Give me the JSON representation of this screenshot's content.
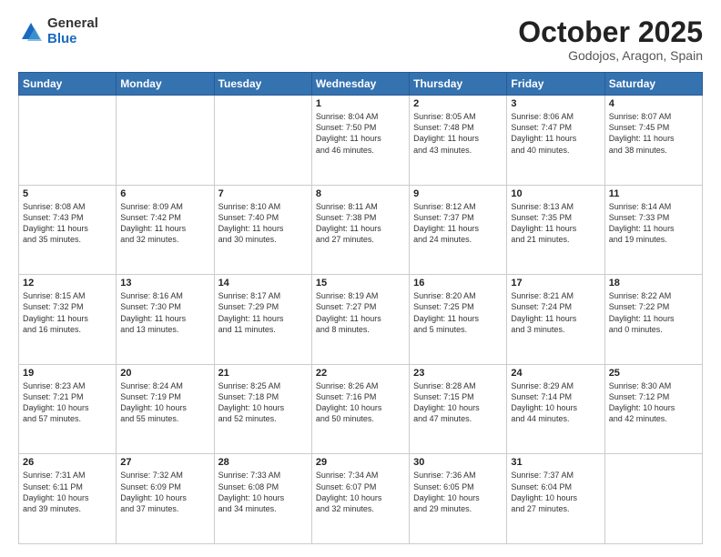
{
  "logo": {
    "general": "General",
    "blue": "Blue"
  },
  "title": "October 2025",
  "location": "Godojos, Aragon, Spain",
  "days_of_week": [
    "Sunday",
    "Monday",
    "Tuesday",
    "Wednesday",
    "Thursday",
    "Friday",
    "Saturday"
  ],
  "weeks": [
    [
      {
        "day": "",
        "info": ""
      },
      {
        "day": "",
        "info": ""
      },
      {
        "day": "",
        "info": ""
      },
      {
        "day": "1",
        "info": "Sunrise: 8:04 AM\nSunset: 7:50 PM\nDaylight: 11 hours\nand 46 minutes."
      },
      {
        "day": "2",
        "info": "Sunrise: 8:05 AM\nSunset: 7:48 PM\nDaylight: 11 hours\nand 43 minutes."
      },
      {
        "day": "3",
        "info": "Sunrise: 8:06 AM\nSunset: 7:47 PM\nDaylight: 11 hours\nand 40 minutes."
      },
      {
        "day": "4",
        "info": "Sunrise: 8:07 AM\nSunset: 7:45 PM\nDaylight: 11 hours\nand 38 minutes."
      }
    ],
    [
      {
        "day": "5",
        "info": "Sunrise: 8:08 AM\nSunset: 7:43 PM\nDaylight: 11 hours\nand 35 minutes."
      },
      {
        "day": "6",
        "info": "Sunrise: 8:09 AM\nSunset: 7:42 PM\nDaylight: 11 hours\nand 32 minutes."
      },
      {
        "day": "7",
        "info": "Sunrise: 8:10 AM\nSunset: 7:40 PM\nDaylight: 11 hours\nand 30 minutes."
      },
      {
        "day": "8",
        "info": "Sunrise: 8:11 AM\nSunset: 7:38 PM\nDaylight: 11 hours\nand 27 minutes."
      },
      {
        "day": "9",
        "info": "Sunrise: 8:12 AM\nSunset: 7:37 PM\nDaylight: 11 hours\nand 24 minutes."
      },
      {
        "day": "10",
        "info": "Sunrise: 8:13 AM\nSunset: 7:35 PM\nDaylight: 11 hours\nand 21 minutes."
      },
      {
        "day": "11",
        "info": "Sunrise: 8:14 AM\nSunset: 7:33 PM\nDaylight: 11 hours\nand 19 minutes."
      }
    ],
    [
      {
        "day": "12",
        "info": "Sunrise: 8:15 AM\nSunset: 7:32 PM\nDaylight: 11 hours\nand 16 minutes."
      },
      {
        "day": "13",
        "info": "Sunrise: 8:16 AM\nSunset: 7:30 PM\nDaylight: 11 hours\nand 13 minutes."
      },
      {
        "day": "14",
        "info": "Sunrise: 8:17 AM\nSunset: 7:29 PM\nDaylight: 11 hours\nand 11 minutes."
      },
      {
        "day": "15",
        "info": "Sunrise: 8:19 AM\nSunset: 7:27 PM\nDaylight: 11 hours\nand 8 minutes."
      },
      {
        "day": "16",
        "info": "Sunrise: 8:20 AM\nSunset: 7:25 PM\nDaylight: 11 hours\nand 5 minutes."
      },
      {
        "day": "17",
        "info": "Sunrise: 8:21 AM\nSunset: 7:24 PM\nDaylight: 11 hours\nand 3 minutes."
      },
      {
        "day": "18",
        "info": "Sunrise: 8:22 AM\nSunset: 7:22 PM\nDaylight: 11 hours\nand 0 minutes."
      }
    ],
    [
      {
        "day": "19",
        "info": "Sunrise: 8:23 AM\nSunset: 7:21 PM\nDaylight: 10 hours\nand 57 minutes."
      },
      {
        "day": "20",
        "info": "Sunrise: 8:24 AM\nSunset: 7:19 PM\nDaylight: 10 hours\nand 55 minutes."
      },
      {
        "day": "21",
        "info": "Sunrise: 8:25 AM\nSunset: 7:18 PM\nDaylight: 10 hours\nand 52 minutes."
      },
      {
        "day": "22",
        "info": "Sunrise: 8:26 AM\nSunset: 7:16 PM\nDaylight: 10 hours\nand 50 minutes."
      },
      {
        "day": "23",
        "info": "Sunrise: 8:28 AM\nSunset: 7:15 PM\nDaylight: 10 hours\nand 47 minutes."
      },
      {
        "day": "24",
        "info": "Sunrise: 8:29 AM\nSunset: 7:14 PM\nDaylight: 10 hours\nand 44 minutes."
      },
      {
        "day": "25",
        "info": "Sunrise: 8:30 AM\nSunset: 7:12 PM\nDaylight: 10 hours\nand 42 minutes."
      }
    ],
    [
      {
        "day": "26",
        "info": "Sunrise: 7:31 AM\nSunset: 6:11 PM\nDaylight: 10 hours\nand 39 minutes."
      },
      {
        "day": "27",
        "info": "Sunrise: 7:32 AM\nSunset: 6:09 PM\nDaylight: 10 hours\nand 37 minutes."
      },
      {
        "day": "28",
        "info": "Sunrise: 7:33 AM\nSunset: 6:08 PM\nDaylight: 10 hours\nand 34 minutes."
      },
      {
        "day": "29",
        "info": "Sunrise: 7:34 AM\nSunset: 6:07 PM\nDaylight: 10 hours\nand 32 minutes."
      },
      {
        "day": "30",
        "info": "Sunrise: 7:36 AM\nSunset: 6:05 PM\nDaylight: 10 hours\nand 29 minutes."
      },
      {
        "day": "31",
        "info": "Sunrise: 7:37 AM\nSunset: 6:04 PM\nDaylight: 10 hours\nand 27 minutes."
      },
      {
        "day": "",
        "info": ""
      }
    ]
  ]
}
